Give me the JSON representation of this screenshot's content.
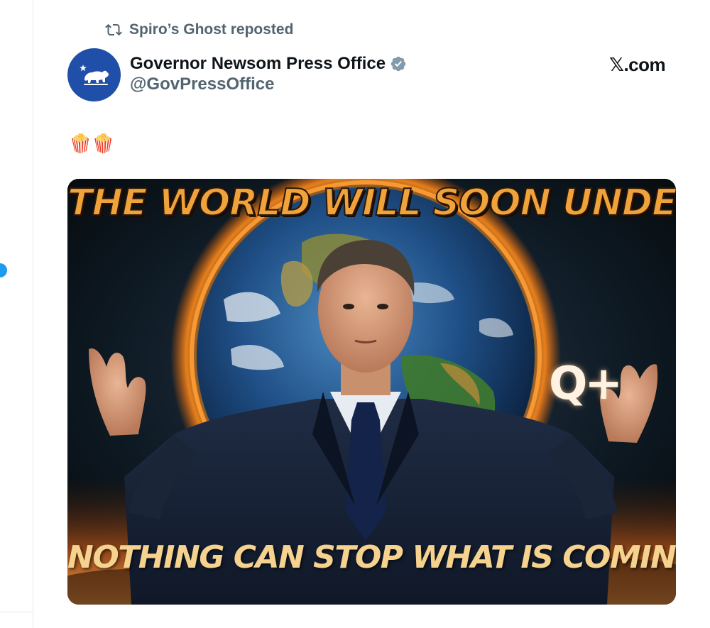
{
  "retweet": {
    "label": "Spiro’s Ghost reposted",
    "icon": "repost-icon"
  },
  "author": {
    "name": "Governor Newsom Press Office",
    "handle": "@GovPressOffice",
    "verified": true,
    "avatar_icon": "california-bear-icon",
    "avatar_color": "#1f4fa8"
  },
  "site_mark": "𝕏.com",
  "tweet": {
    "text": "🍿🍿"
  },
  "media": {
    "caption_top": "THE WORLD WILL SOON UNDERSTAND",
    "caption_bottom": "NOTHING CAN STOP WHAT IS COMING",
    "overlay_text": "Q+"
  },
  "colors": {
    "secondary_text": "#536471",
    "primary_text": "#0f1419",
    "verified_badge": "#829aab",
    "accent": "#1d9bf0"
  }
}
